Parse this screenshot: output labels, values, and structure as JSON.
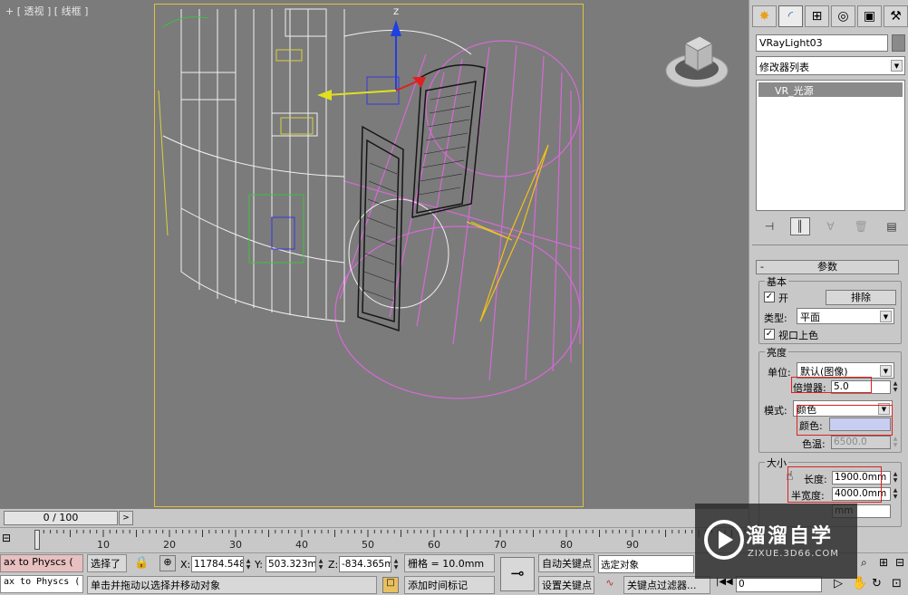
{
  "viewport": {
    "label": "+ [ 透视 ] [ 线框 ]"
  },
  "command_panel": {
    "tabs": [
      "create-icon",
      "modify-icon",
      "hierarchy-icon",
      "motion-icon",
      "display-icon",
      "utilities-icon"
    ],
    "object_name": "VRayLight03",
    "modifier_list": "修改器列表",
    "stack_item": "VR_光源",
    "params_title": "参数",
    "basic": {
      "title": "基本",
      "on_label": "开",
      "on_checked": true,
      "exclude_button": "排除",
      "type_label": "类型:",
      "type_value": "平面",
      "viewport_color_label": "视口上色",
      "viewport_color_checked": true
    },
    "intensity": {
      "title": "亮度",
      "unit_label": "单位:",
      "unit_value": "默认(图像)",
      "multiplier_label": "倍增器:",
      "multiplier_value": "5.0",
      "mode_label": "模式:",
      "mode_value": "颜色",
      "color_label": "颜色:",
      "color_value": "#c8cdf2",
      "temperature_label": "色温:",
      "temperature_value": "6500.0"
    },
    "size": {
      "title": "大小",
      "length_label": "长度:",
      "length_value": "1900.0mm",
      "width_label": "半宽度:",
      "width_value": "4000.0mm",
      "third_value": "mm"
    }
  },
  "timeline": {
    "slider_text": "0 / 100",
    "next_label": ">",
    "ticks": [
      "0",
      "10",
      "20",
      "30",
      "40",
      "50",
      "60",
      "70",
      "80",
      "90"
    ]
  },
  "status": {
    "script_listener": "ax to Physcs (",
    "selection_text": "选择了",
    "x_label": "X:",
    "x_value": "11784.548",
    "y_label": "Y:",
    "y_value": "503.323mm",
    "z_label": "Z:",
    "z_value": "-834.365m",
    "grid_text": "栅格 = 10.0mm",
    "prompt_text": "单击并拖动以选择并移动对象",
    "add_time_tag": "添加时间标记",
    "auto_key": "自动关键点",
    "set_key": "设置关键点",
    "selected_object": "选定对象",
    "key_filters": "关键点过滤器...",
    "frame_value": "0"
  },
  "watermark": {
    "title": "溜溜自学",
    "subtitle": "ZIXUE.3D66.COM"
  },
  "colors": {
    "viewport_bg": "#7b7b7b",
    "frame": "#e0c23a",
    "light_wire": "#d66ad6",
    "door_wire": "#1a1a1a",
    "highlight_red": "#e02020"
  }
}
